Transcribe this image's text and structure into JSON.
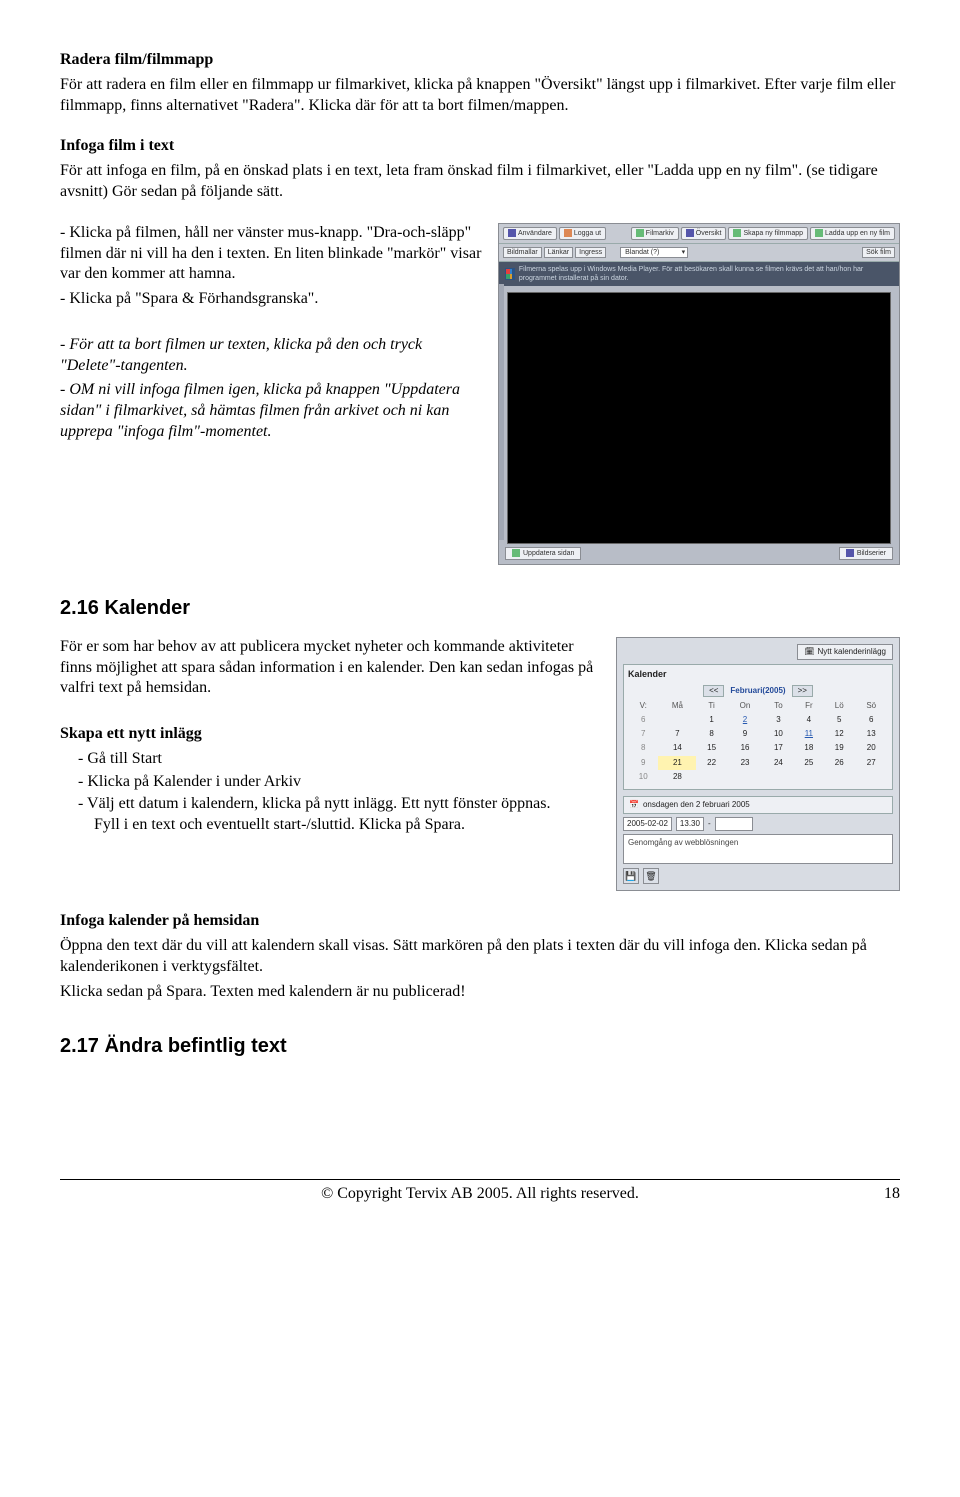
{
  "section1": {
    "heading": "Radera film/filmmapp",
    "p1": "För att radera en film eller en filmmapp ur filmarkivet, klicka på knappen \"Översikt\" längst upp i filmarkivet. Efter varje film eller filmmapp, finns alternativet \"Radera\". Klicka där för att ta bort filmen/mappen."
  },
  "section2": {
    "heading": "Infoga film i text",
    "p1": "För att infoga en film, på en önskad plats i en text, leta fram önskad film i filmarkivet, eller \"Ladda upp en ny film\". (se tidigare avsnitt) Gör sedan på följande sätt."
  },
  "section3": {
    "p1": "- Klicka på filmen, håll ner vänster mus-knapp. \"Dra-och-släpp\" filmen där ni vill ha den i texten. En liten blinkade \"markör\" visar var den kommer att hamna.",
    "p2": "- Klicka på \"Spara & Förhandsgranska\".",
    "p3": "- För att ta bort filmen ur texten, klicka på den och tryck \"Delete\"-tangenten.",
    "p4": "- OM ni vill infoga filmen igen, klicka på knappen \"Uppdatera sidan\" i filmarkivet, så hämtas filmen från arkivet och ni kan upprepa \"infoga film\"-momentet."
  },
  "shot1": {
    "toolbar1": {
      "btn1": "Användare",
      "btn2": "Logga ut",
      "btn3": "Filmarkiv",
      "btn4": "Översikt",
      "btn5": "Skapa ny filmmapp",
      "btn6": "Ladda upp en ny film"
    },
    "toolbar2": {
      "b1": "Bildmallar",
      "b2": "Länkar",
      "b3": "Ingress",
      "sel": "Blandat (?)",
      "sok": "Sök film"
    },
    "blue": "Filmerna spelas upp i Windows Media Player. För att besökaren skall kunna se filmen krävs det att han/hon har programmet installerat på sin dator.",
    "bottom": {
      "upd": "Uppdatera sidan",
      "tab": "Bildserier"
    }
  },
  "h216": "2.16   Kalender",
  "section4": {
    "p1": "För er som har behov av att publicera mycket nyheter och kommande aktiviteter finns möjlighet att spara sådan information i en kalender. Den kan sedan infogas på valfri text på hemsidan."
  },
  "section5": {
    "heading": "Skapa ett nytt inlägg",
    "li1": "Gå till Start",
    "li2": "Klicka på Kalender i under Arkiv",
    "li3": "Välj ett datum i kalendern, klicka på nytt inlägg. Ett nytt fönster öppnas.",
    "li3b": "Fyll i en text och eventuellt start-/sluttid. Klicka på Spara."
  },
  "shot2": {
    "newbtn": "Nytt kalenderinlägg",
    "title": "Kalender",
    "prev": "<<",
    "month": "Februari(2005)",
    "next": ">>",
    "hdr": {
      "v": "V:",
      "ma": "Må",
      "ti": "Ti",
      "on": "On",
      "to": "To",
      "fr": "Fr",
      "lo": "Lö",
      "so": "Sö"
    },
    "rows": [
      {
        "wk": "6",
        "c": [
          "",
          "1",
          "2",
          "3",
          "4",
          "5",
          "6"
        ],
        "links": [
          2
        ],
        "hl": []
      },
      {
        "wk": "7",
        "c": [
          "7",
          "8",
          "9",
          "10",
          "11",
          "12",
          "13"
        ],
        "links": [
          4
        ],
        "hl": []
      },
      {
        "wk": "8",
        "c": [
          "14",
          "15",
          "16",
          "17",
          "18",
          "19",
          "20"
        ],
        "links": [],
        "hl": []
      },
      {
        "wk": "9",
        "c": [
          "21",
          "22",
          "23",
          "24",
          "25",
          "26",
          "27"
        ],
        "links": [],
        "hl": [
          0
        ]
      },
      {
        "wk": "10",
        "c": [
          "28",
          "",
          "",
          "",
          "",
          "",
          ""
        ],
        "links": [],
        "hl": []
      }
    ],
    "eventday": "onsdagen den 2 februari 2005",
    "date": "2005-02-02",
    "time": "13.30",
    "dash": "-",
    "desc": "Genomgång av webblösningen"
  },
  "section6": {
    "heading": "Infoga kalender på hemsidan",
    "p1": "Öppna den text där du vill att kalendern skall visas. Sätt markören på den plats i texten där du vill infoga den. Klicka sedan på kalenderikonen i verktygsfältet.",
    "p2": "Klicka sedan på Spara. Texten med kalendern är nu publicerad!"
  },
  "h217": "2.17   Ändra befintlig text",
  "footer": {
    "copyright": "© Copyright Tervix AB 2005. All rights reserved.",
    "page": "18"
  }
}
